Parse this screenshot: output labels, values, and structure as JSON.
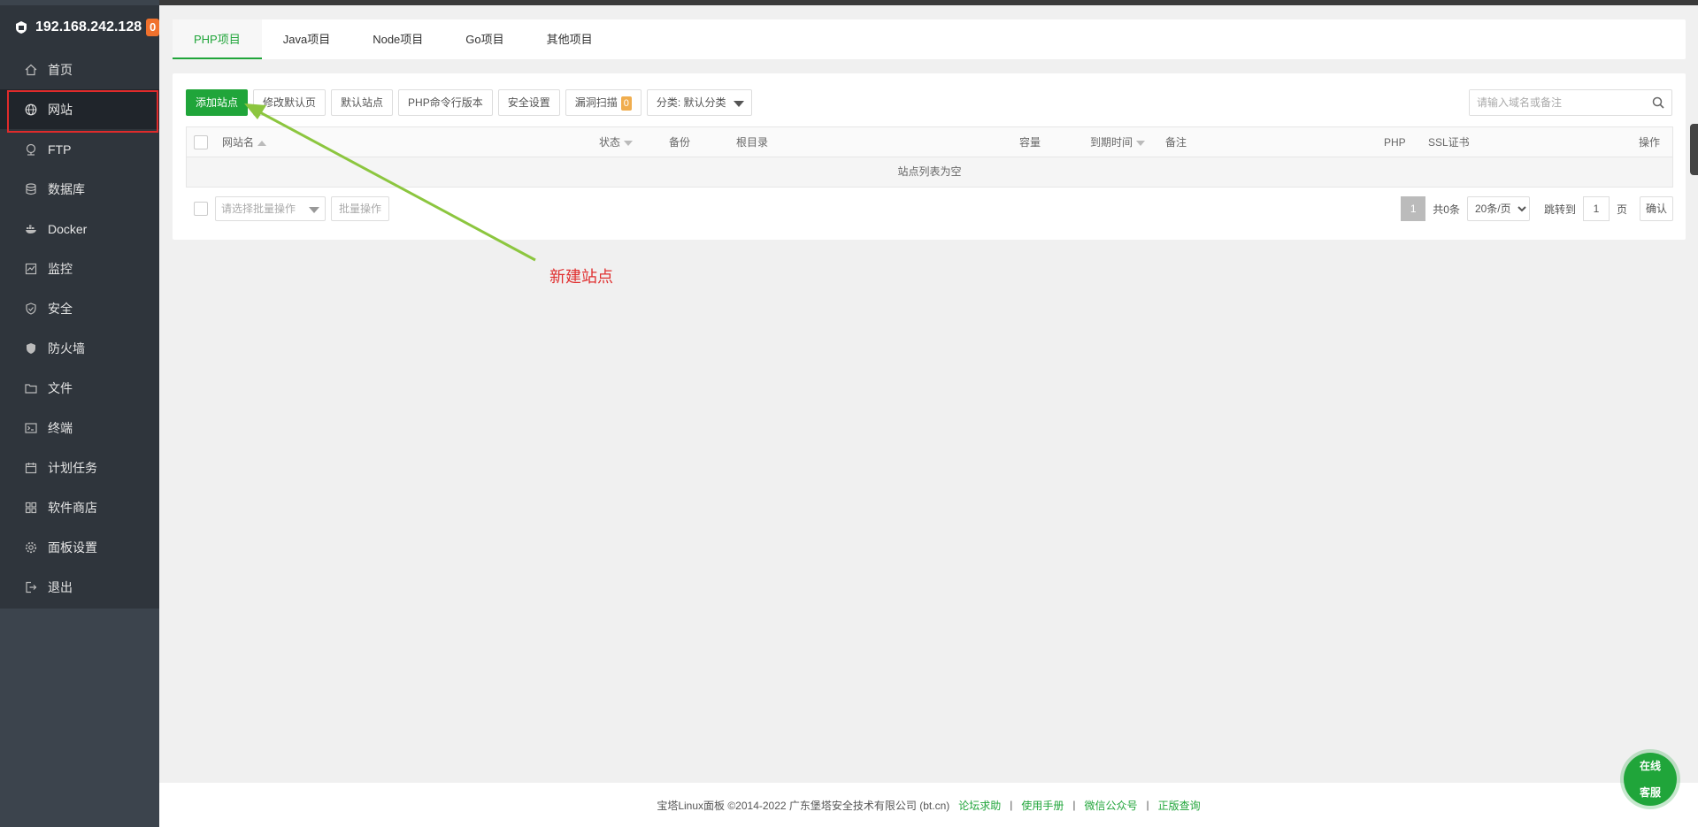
{
  "server": {
    "ip": "192.168.242.128",
    "badge": "0"
  },
  "sidebar": {
    "items": [
      {
        "label": "首页",
        "icon": "home-icon"
      },
      {
        "label": "网站",
        "icon": "globe-icon",
        "active": true
      },
      {
        "label": "FTP",
        "icon": "ftp-icon"
      },
      {
        "label": "数据库",
        "icon": "database-icon"
      },
      {
        "label": "Docker",
        "icon": "docker-icon"
      },
      {
        "label": "监控",
        "icon": "monitor-icon"
      },
      {
        "label": "安全",
        "icon": "shield-check-icon"
      },
      {
        "label": "防火墙",
        "icon": "firewall-icon"
      },
      {
        "label": "文件",
        "icon": "folder-icon"
      },
      {
        "label": "终端",
        "icon": "terminal-icon"
      },
      {
        "label": "计划任务",
        "icon": "calendar-icon"
      },
      {
        "label": "软件商店",
        "icon": "apps-icon"
      },
      {
        "label": "面板设置",
        "icon": "gear-icon"
      },
      {
        "label": "退出",
        "icon": "logout-icon"
      }
    ]
  },
  "tabs": [
    "PHP项目",
    "Java项目",
    "Node项目",
    "Go项目",
    "其他项目"
  ],
  "toolbar": {
    "add_site": "添加站点",
    "edit_default_page": "修改默认页",
    "default_site": "默认站点",
    "php_cli_version": "PHP命令行版本",
    "security_settings": "安全设置",
    "vuln_scan": "漏洞扫描",
    "vuln_count": "0",
    "category": "分类: 默认分类"
  },
  "search": {
    "placeholder": "请输入域名或备注"
  },
  "table": {
    "columns": {
      "site_name": "网站名",
      "status": "状态",
      "backup": "备份",
      "root": "根目录",
      "capacity": "容量",
      "expire": "到期时间",
      "remark": "备注",
      "php": "PHP",
      "ssl": "SSL证书",
      "actions": "操作"
    },
    "empty_text": "站点列表为空"
  },
  "bulk": {
    "placeholder": "请选择批量操作",
    "button": "批量操作"
  },
  "pager": {
    "current": "1",
    "total": "共0条",
    "page_size": "20条/页",
    "jump_label": "跳转到",
    "jump_value": "1",
    "unit": "页",
    "confirm": "确认"
  },
  "annotation": {
    "text": "新建站点",
    "color": "#e03030",
    "arrow_color": "#8cc63f"
  },
  "footer": {
    "copyright": "宝塔Linux面板 ©2014-2022 广东堡塔安全技术有限公司 (bt.cn)",
    "links": [
      "论坛求助",
      "使用手册",
      "微信公众号",
      "正版查询"
    ]
  },
  "customer_service": {
    "line1": "在线",
    "line2": "客服"
  },
  "colors": {
    "accent": "#20a53a",
    "sidebar_bg": "#2f353c",
    "badge": "#f0712d"
  }
}
